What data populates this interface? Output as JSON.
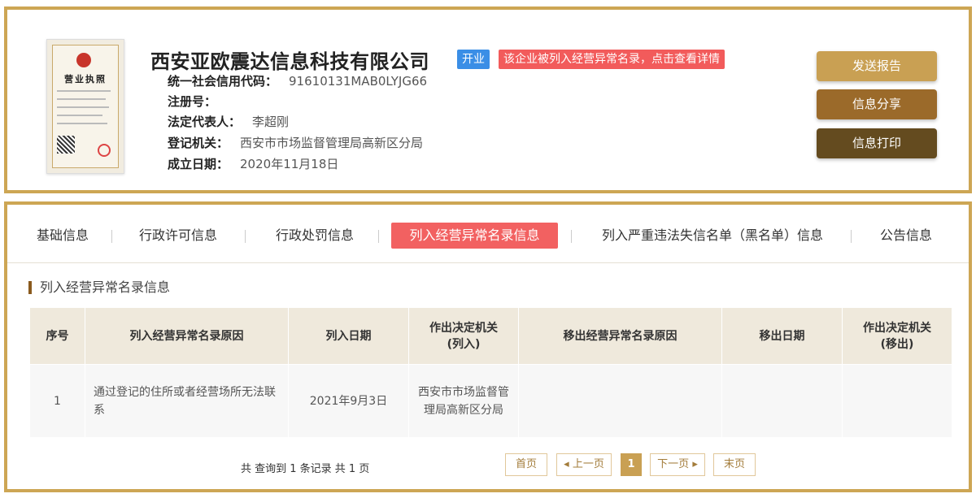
{
  "company": {
    "name": "西安亚欧震达信息科技有限公司",
    "status": "开业",
    "alert": "该企业被列入经营异常名录，点击查看详情",
    "license_title": "营业执照"
  },
  "info": [
    {
      "label": "统一社会信用代码：",
      "value": "91610131MAB0LYJG66"
    },
    {
      "label": "注册号：",
      "value": ""
    },
    {
      "label": "法定代表人：",
      "value": "李超刚"
    },
    {
      "label": "登记机关：",
      "value": "西安市市场监督管理局高新区分局"
    },
    {
      "label": "成立日期：",
      "value": "2020年11月18日"
    }
  ],
  "actions": {
    "report": "发送报告",
    "share": "信息分享",
    "print": "信息打印"
  },
  "tabs": [
    {
      "label": "基础信息",
      "active": false
    },
    {
      "label": "行政许可信息",
      "active": false
    },
    {
      "label": "行政处罚信息",
      "active": false
    },
    {
      "label": "列入经营异常名录信息",
      "active": true
    },
    {
      "label": "列入严重违法失信名单（黑名单）信息",
      "active": false
    },
    {
      "label": "公告信息",
      "active": false
    }
  ],
  "section_title": "列入经营异常名录信息",
  "table": {
    "headers": [
      "序号",
      "列入经营异常名录原因",
      "列入日期",
      "作出决定机关\n(列入)",
      "移出经营异常名录原因",
      "移出日期",
      "作出决定机关\n(移出)"
    ],
    "rows": [
      [
        "1",
        "通过登记的住所或者经营场所无法联系",
        "2021年9月3日",
        "西安市市场监督管理局高新区分局",
        "",
        "",
        ""
      ]
    ]
  },
  "pagination": {
    "summary": "共 查询到 1 条记录 共 1 页",
    "first": "首页",
    "prev": "上一页",
    "current": "1",
    "next": "下一页",
    "last": "末页"
  },
  "colors": {
    "accent_gold": "#cda654",
    "active_tab": "#f26161",
    "status_blue": "#3a8ee6"
  }
}
